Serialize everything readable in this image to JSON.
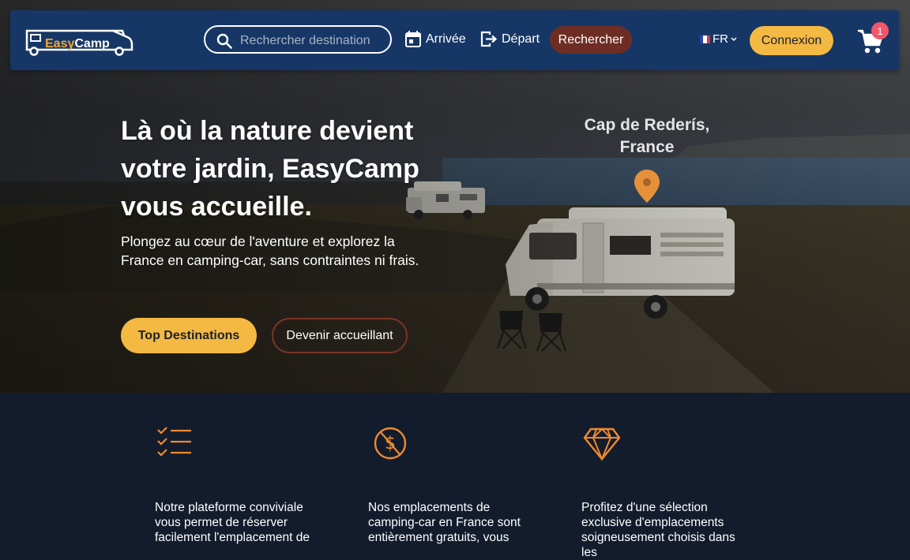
{
  "brand": {
    "logo_easy": "Easy",
    "logo_camp": "Camp",
    "accent": "#f4b942",
    "nav_bg": "#163766"
  },
  "nav": {
    "search_placeholder": "Rechercher destination",
    "arrival_label": "Arrivée",
    "departure_label": "Départ",
    "search_button": "Rechercher",
    "language": "FR",
    "login_button": "Connexion",
    "cart_count": "1"
  },
  "hero": {
    "title": "Là où la nature devient votre jardin, EasyCamp vous accueille.",
    "subtitle": "Plongez au cœur de l'aventure et explorez la France en camping-car, sans contraintes ni frais.",
    "primary_button": "Top Destinations",
    "secondary_button": "Devenir accueillant",
    "location_name": "Cap de Rederís,",
    "location_country": "France"
  },
  "features": [
    {
      "icon": "checklist-icon",
      "text": "Notre plateforme conviviale vous permet de réserver facilement l'emplacement de"
    },
    {
      "icon": "no-dollar-icon",
      "text": "Nos emplacements de camping-car en France sont entièrement gratuits, vous"
    },
    {
      "icon": "diamond-icon",
      "text": "Profitez d'une sélection exclusive d'emplacements soigneusement choisis dans les"
    }
  ]
}
